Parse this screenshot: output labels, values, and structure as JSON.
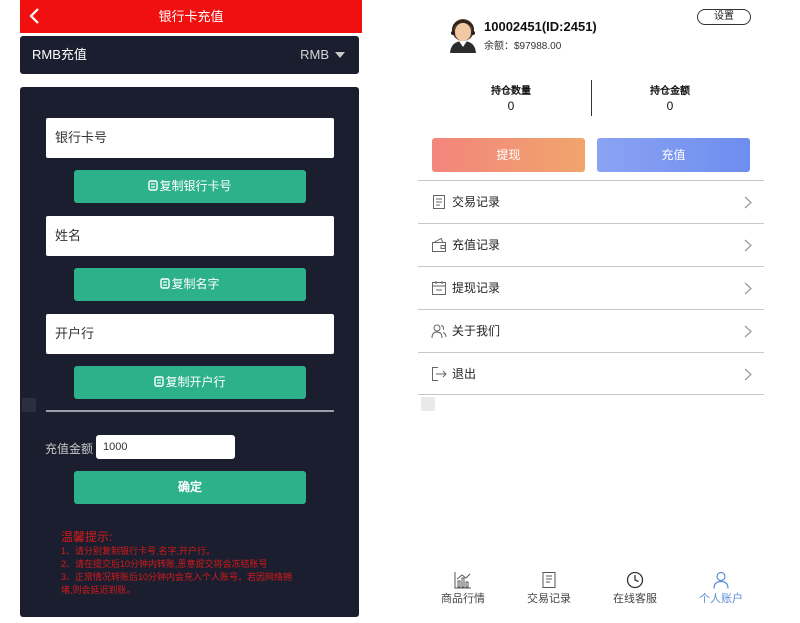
{
  "left": {
    "header": {
      "title": "银行卡充值"
    },
    "method": {
      "label": "RMB充值",
      "currency": "RMB"
    },
    "fields": [
      {
        "label": "银行卡号",
        "copy_label": "复制银行卡号"
      },
      {
        "label": "姓名",
        "copy_label": "复制名字"
      },
      {
        "label": "开户行",
        "copy_label": "复制开户行"
      }
    ],
    "amount": {
      "label": "充值金额",
      "value": "1000"
    },
    "confirm_label": "确定",
    "tips": {
      "title": "温馨提示:",
      "lines": [
        "1、请分别复制银行卡号,名字,开户行。",
        "2、请在提交后10分钟内转账,恶意提交将会冻结账号",
        "3、正常情况转账后10分钟内会充入个人账号。若因网络拥",
        "堵,则会延迟到账。"
      ]
    }
  },
  "right": {
    "user": {
      "id_text": "10002451(ID:2451)",
      "balance": "余额：$97988.00"
    },
    "settings_label": "设置",
    "stats": [
      {
        "label": "持仓数量",
        "value": "0"
      },
      {
        "label": "持仓金额",
        "value": "0"
      }
    ],
    "actions": {
      "withdraw": "提现",
      "recharge": "充值"
    },
    "menu": [
      {
        "label": "交易记录",
        "icon": "document-icon"
      },
      {
        "label": "充值记录",
        "icon": "wallet-icon"
      },
      {
        "label": "提现记录",
        "icon": "calendar-icon"
      },
      {
        "label": "关于我们",
        "icon": "people-icon"
      },
      {
        "label": "退出",
        "icon": "logout-icon"
      }
    ],
    "nav": [
      {
        "label": "商品行情",
        "icon": "chart-icon",
        "active": false
      },
      {
        "label": "交易记录",
        "icon": "receipt-icon",
        "active": false
      },
      {
        "label": "在线客服",
        "icon": "clock-icon",
        "active": false
      },
      {
        "label": "个人账户",
        "icon": "user-icon",
        "active": true
      }
    ]
  },
  "colors": {
    "header_red": "#f01010",
    "panel_dark": "#1b1e2e",
    "copy_green": "#2db18a",
    "tip_red": "#d51a1a",
    "nav_active": "#5c8ed6"
  }
}
